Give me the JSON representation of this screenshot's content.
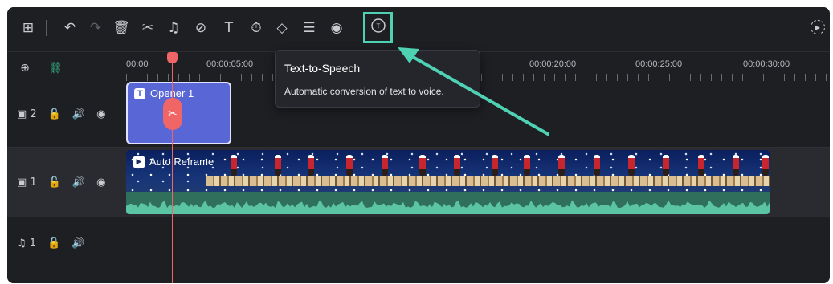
{
  "toolbar": {
    "icons": [
      "multi-clip-icon",
      "undo-icon",
      "redo-icon",
      "delete-icon",
      "cut-icon",
      "audio-icon",
      "tag-icon",
      "text-icon",
      "speed-icon",
      "keyframe-icon",
      "adjust-icon",
      "voice-icon",
      "text-to-speech-icon",
      "render-preview-icon"
    ]
  },
  "tooltip": {
    "title": "Text-to-Speech",
    "description": "Automatic conversion of text to voice."
  },
  "ruler": {
    "ticks": [
      "00:00",
      "00:00:05:00",
      "00:00:20:00",
      "00:00:25:00",
      "00:00:30:00"
    ]
  },
  "tracks": [
    {
      "id": "video-2",
      "label": "2",
      "type": "video"
    },
    {
      "id": "video-1",
      "label": "1",
      "type": "video"
    },
    {
      "id": "audio-1",
      "label": "1",
      "type": "audio"
    }
  ],
  "clips": {
    "text_clip": {
      "label": "Opener 1"
    },
    "video_clip": {
      "label": "Auto Reframe"
    }
  },
  "colors": {
    "highlight": "#4fd1b3",
    "playhead": "#f06565",
    "text_clip": "#5866d6",
    "waveform": "#2f6f5c"
  }
}
